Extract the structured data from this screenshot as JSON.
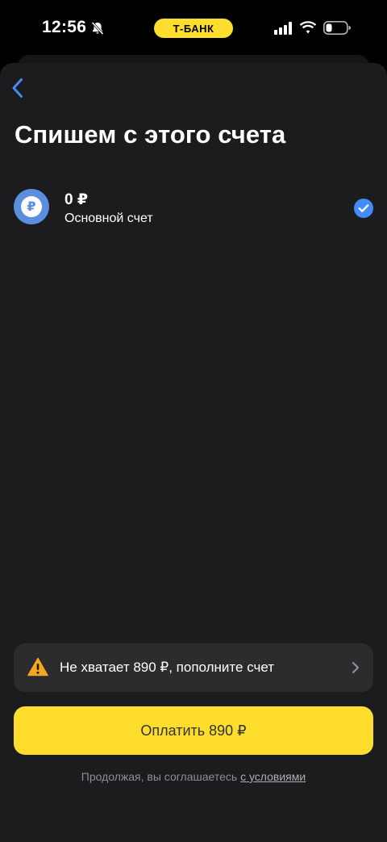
{
  "status_bar": {
    "time": "12:56",
    "brand": "Т-БАНК"
  },
  "header": {
    "title": "Спишем с этого счета"
  },
  "account": {
    "balance": "0 ₽",
    "name": "Основной счет",
    "currency_symbol": "₽",
    "selected": true
  },
  "warning": {
    "text": "Не хватает 890 ₽, пополните счет"
  },
  "pay_button": {
    "label": "Оплатить 890 ₽"
  },
  "terms": {
    "prefix": "Продолжая, вы соглашаетесь ",
    "link": "с условиями"
  },
  "icons": {
    "back": "chevron-left-icon",
    "bell": "bell-muted-icon",
    "signal": "signal-icon",
    "wifi": "wifi-icon",
    "battery": "battery-icon",
    "check": "checkmark-circle-icon",
    "warning": "warning-triangle-icon",
    "chevron": "chevron-right-icon"
  },
  "colors": {
    "accent_yellow": "#ffdd2d",
    "accent_blue": "#428bf9",
    "background": "#1c1c1e",
    "card": "#2c2c2e",
    "warning": "#f5a623"
  }
}
